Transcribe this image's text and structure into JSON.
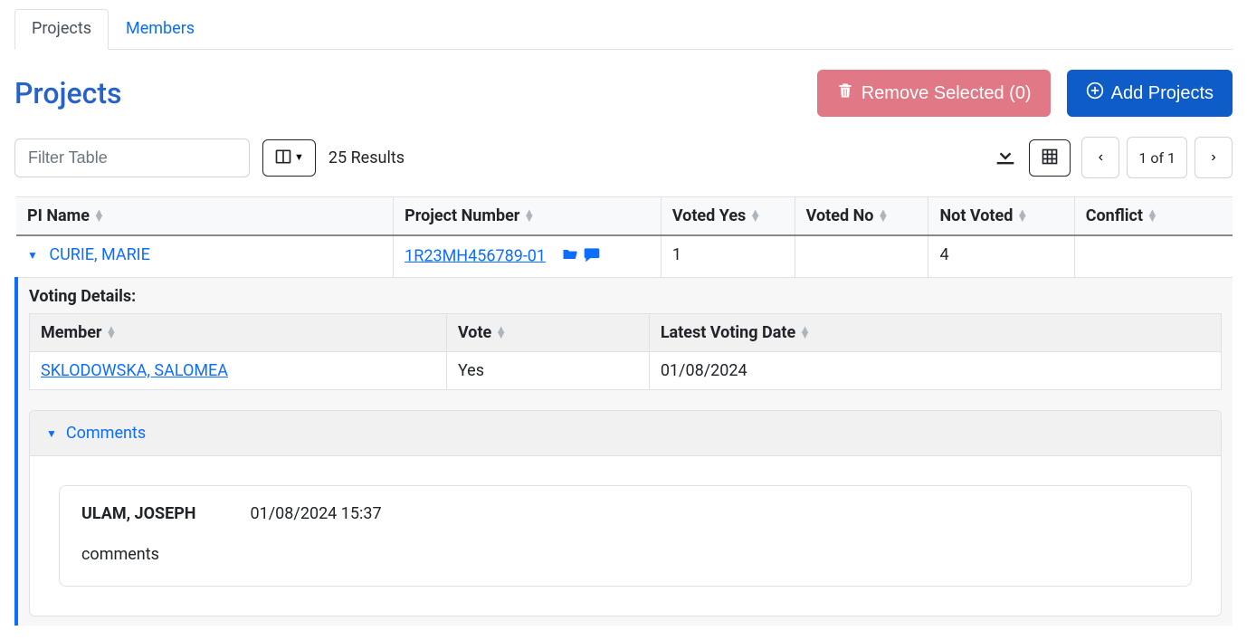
{
  "tabs": {
    "projects": "Projects",
    "members": "Members"
  },
  "title": "Projects",
  "buttons": {
    "remove": "Remove Selected (0)",
    "add": "Add Projects"
  },
  "filter_placeholder": "Filter Table",
  "results_text": "25 Results",
  "pager_text": "1 of 1",
  "columns": {
    "pi": "PI Name",
    "project": "Project Number",
    "yes": "Voted Yes",
    "no": "Voted No",
    "notvoted": "Not Voted",
    "conflict": "Conflict"
  },
  "row": {
    "pi_name": "CURIE, MARIE",
    "project_number": "1R23MH456789-01",
    "voted_yes": "1",
    "voted_no": "",
    "not_voted": "4",
    "conflict": ""
  },
  "details": {
    "title": "Voting Details:",
    "cols": {
      "member": "Member",
      "vote": "Vote",
      "date": "Latest Voting Date"
    },
    "row": {
      "member": "SKLODOWSKA, SALOMEA",
      "vote": "Yes",
      "date": "01/08/2024"
    }
  },
  "comments": {
    "header": "Comments",
    "author": "ULAM, JOSEPH",
    "ts": "01/08/2024 15:37",
    "text": "comments"
  }
}
